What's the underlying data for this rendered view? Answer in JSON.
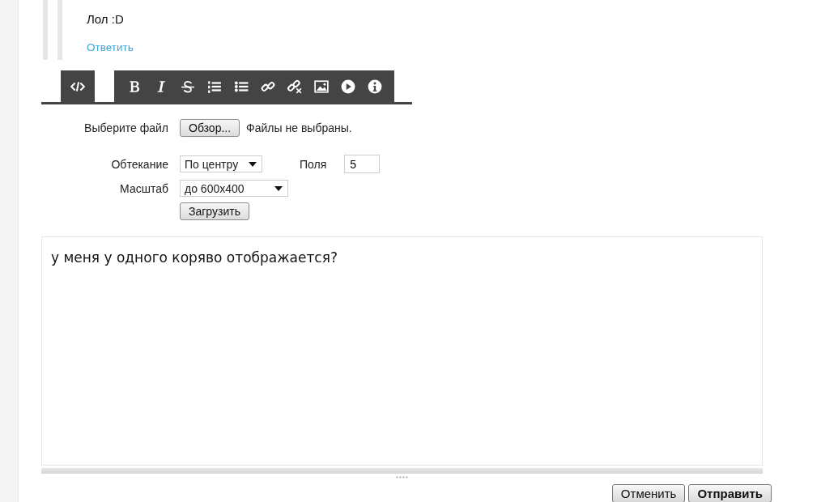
{
  "quote": {
    "text": "Лол :D",
    "reply_link": "Ответить"
  },
  "toolbar": {
    "groups": [
      [
        {
          "kind": "source"
        }
      ],
      [
        {
          "kind": "bold"
        },
        {
          "kind": "italic"
        },
        {
          "kind": "strike"
        },
        {
          "kind": "ordered-list"
        },
        {
          "kind": "bullet-list"
        },
        {
          "kind": "link"
        },
        {
          "kind": "unlink"
        },
        {
          "kind": "image"
        },
        {
          "kind": "video"
        },
        {
          "kind": "info"
        }
      ]
    ]
  },
  "upload_form": {
    "file_label": "Выберите файл",
    "browse_button": "Обзор...",
    "file_status": "Файлы не выбраны.",
    "wrap_label": "Обтекание",
    "wrap_value": "По центру",
    "margins_label": "Поля",
    "margins_value": "5",
    "scale_label": "Масштаб",
    "scale_value": "до 600x400",
    "upload_button": "Загрузить"
  },
  "editor": {
    "text": "у меня у одного коряво отображается?"
  },
  "buttons": [
    {
      "label": "Отменить",
      "kind": "cancel"
    },
    {
      "label": "Отправить",
      "kind": "submit"
    }
  ]
}
